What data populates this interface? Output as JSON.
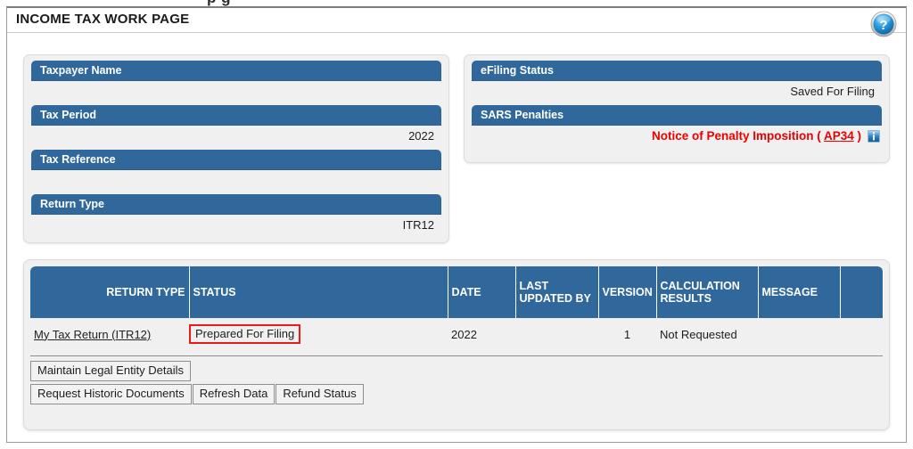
{
  "ghost_text": "p g",
  "header": {
    "title": "INCOME TAX WORK PAGE",
    "help_icon": "question-mark-help-icon"
  },
  "colors": {
    "header_blue": "#31689c",
    "panel_bg": "#f0f0f0",
    "alert_red": "#ee0000",
    "highlight_red": "#e81c1c"
  },
  "left_panel": {
    "fields": [
      {
        "label": "Taxpayer Name",
        "value": ""
      },
      {
        "label": "Tax Period",
        "value": "2022"
      },
      {
        "label": "Tax Reference",
        "value": ""
      },
      {
        "label": "Return Type",
        "value": "ITR12"
      }
    ]
  },
  "right_panel": {
    "status_label": "eFiling Status",
    "status_value": "Saved For Filing",
    "penalties_label": "SARS Penalties",
    "penalty_prefix": "Notice of Penalty Imposition ( ",
    "penalty_link": "AP34",
    "penalty_suffix": " )",
    "info_icon": "information-icon"
  },
  "table": {
    "columns": [
      "RETURN TYPE",
      "STATUS",
      "DATE",
      "LAST UPDATED BY",
      "VERSION",
      "CALCULATION RESULTS",
      "MESSAGE",
      ""
    ],
    "rows": [
      {
        "return_type": "My Tax Return (ITR12)",
        "status": "Prepared For Filing",
        "date": "2022",
        "last_updated_by": "",
        "version": "1",
        "calculation_results": "Not Requested",
        "message": "",
        "extra": ""
      }
    ]
  },
  "buttons": {
    "row1": [
      "Maintain Legal Entity Details"
    ],
    "row2": [
      "Request Historic Documents",
      "Refresh Data",
      "Refund Status"
    ]
  }
}
